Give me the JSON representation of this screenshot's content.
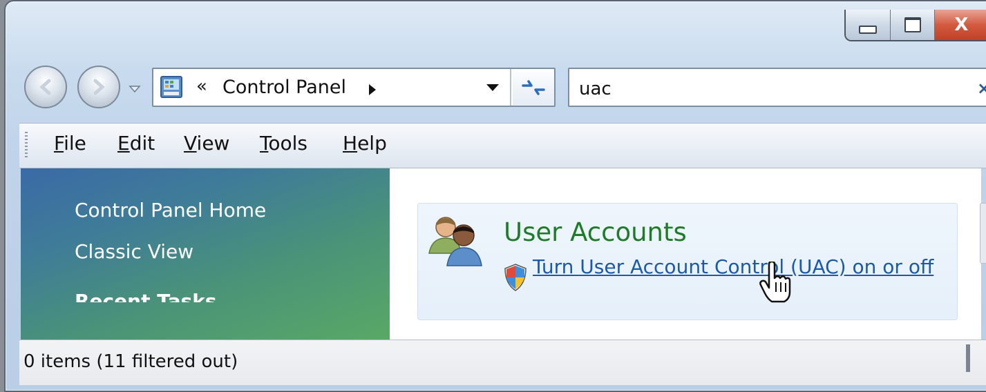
{
  "window": {
    "controls": {
      "minimize_icon": "minimize-icon",
      "maximize_icon": "maximize-icon",
      "close_label": "X"
    }
  },
  "navigation": {
    "back_icon": "back-arrow-icon",
    "forward_icon": "forward-arrow-icon",
    "recent_icon": "recent-pages-dropdown-icon"
  },
  "address_bar": {
    "chevron": "«",
    "location": "Control Panel",
    "icon": "control-panel-icon",
    "refresh_icon": "refresh-icon"
  },
  "search": {
    "value": "uac",
    "clear": "×"
  },
  "menu": {
    "items": [
      {
        "first": "F",
        "rest": "ile"
      },
      {
        "first": "E",
        "rest": "dit"
      },
      {
        "first": "V",
        "rest": "iew"
      },
      {
        "first": "T",
        "rest": "ools"
      },
      {
        "first": "H",
        "rest": "elp"
      }
    ]
  },
  "left_pane": {
    "home": "Control Panel Home",
    "classic": "Classic View",
    "recent_tasks": "Recent Tasks"
  },
  "result": {
    "title": "User Accounts",
    "link": "Turn User Account Control (UAC) on or off",
    "icon": "user-accounts-icon",
    "shield_icon": "uac-shield-icon"
  },
  "status": {
    "text": "0 items (11 filtered out)"
  },
  "colors": {
    "title_green": "#1f7a2a",
    "link_blue": "#1a5aa8",
    "pane_top": "#3a6aa6",
    "pane_bottom": "#5aa866",
    "close_red": "#d35a40"
  }
}
